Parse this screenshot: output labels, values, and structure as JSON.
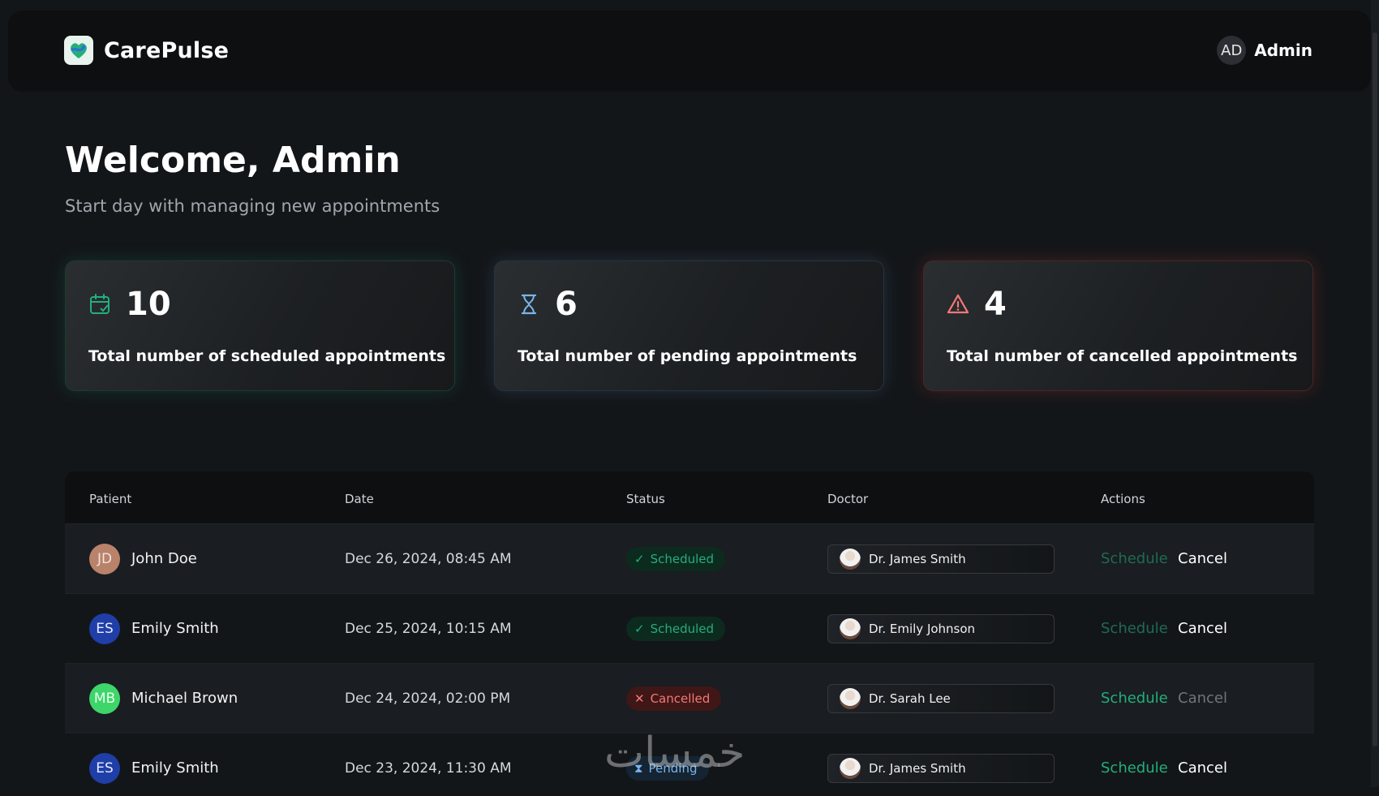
{
  "header": {
    "brand": "CarePulse",
    "user_initials": "AD",
    "user_name": "Admin"
  },
  "welcome": {
    "title": "Welcome, Admin",
    "subtitle": "Start day with managing new appointments"
  },
  "stats": [
    {
      "value": "10",
      "label": "Total number of scheduled appointments",
      "icon": "calendar-check-icon",
      "color": "#24ae7c"
    },
    {
      "value": "6",
      "label": "Total number of pending appointments",
      "icon": "hourglass-icon",
      "color": "#79b5ec"
    },
    {
      "value": "4",
      "label": "Total number of cancelled appointments",
      "icon": "alert-triangle-icon",
      "color": "#f37877"
    }
  ],
  "table": {
    "headers": [
      "Patient",
      "Date",
      "Status",
      "Doctor",
      "Actions"
    ],
    "rows": [
      {
        "initials": "JD",
        "patient": "John Doe",
        "date": "Dec 26, 2024, 08:45 AM",
        "status": "Scheduled",
        "doctor": "Dr. James Smith",
        "schedule": "Schedule",
        "cancel": "Cancel"
      },
      {
        "initials": "ES",
        "patient": "Emily Smith",
        "date": "Dec 25, 2024, 10:15 AM",
        "status": "Scheduled",
        "doctor": "Dr. Emily Johnson",
        "schedule": "Schedule",
        "cancel": "Cancel"
      },
      {
        "initials": "MB",
        "patient": "Michael Brown",
        "date": "Dec 24, 2024, 02:00 PM",
        "status": "Cancelled",
        "doctor": "Dr. Sarah Lee",
        "schedule": "Schedule",
        "cancel": "Cancel"
      },
      {
        "initials": "ES",
        "patient": "Emily Smith",
        "date": "Dec 23, 2024, 11:30 AM",
        "status": "Pending",
        "doctor": "Dr. James Smith",
        "schedule": "Schedule",
        "cancel": "Cancel"
      }
    ]
  },
  "watermark": "خمسات"
}
